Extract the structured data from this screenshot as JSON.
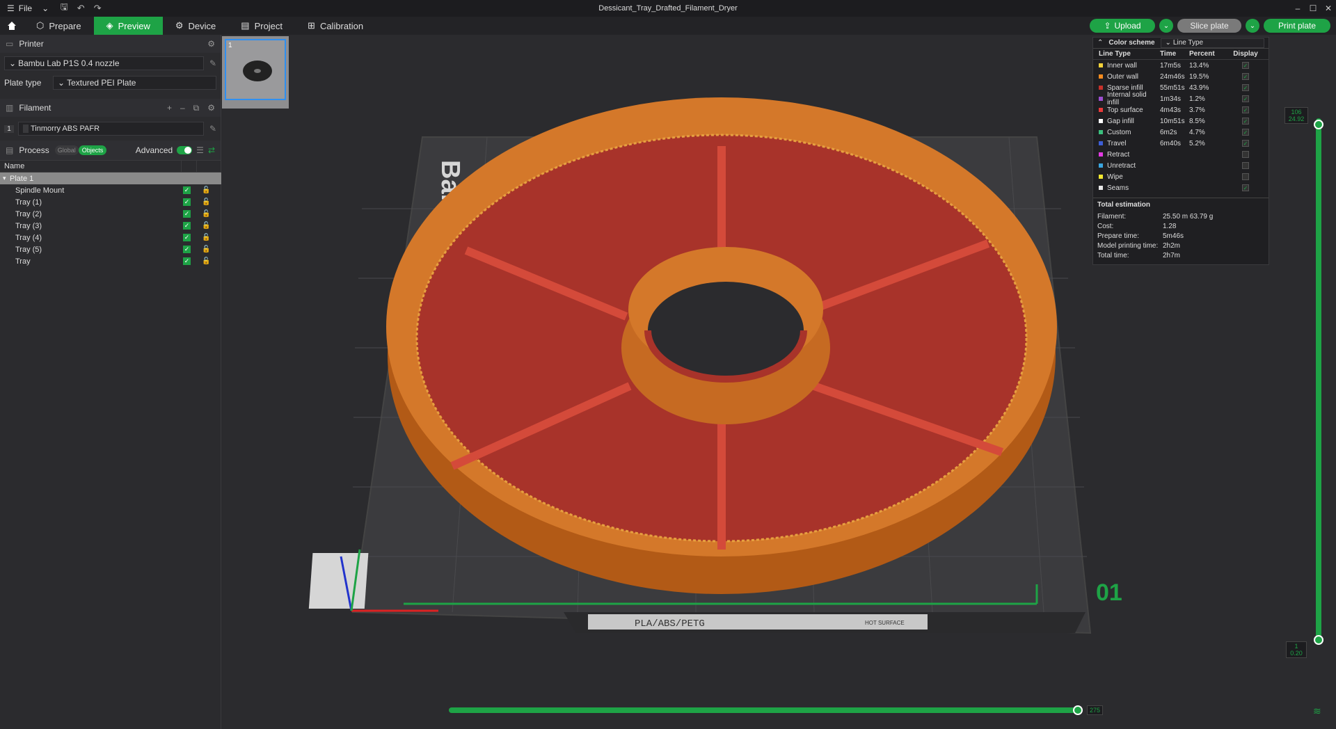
{
  "titlebar": {
    "file_label": "File",
    "title": "Dessicant_Tray_Drafted_Filament_Dryer"
  },
  "tabs": [
    {
      "label": "Prepare"
    },
    {
      "label": "Preview"
    },
    {
      "label": "Device"
    },
    {
      "label": "Project"
    },
    {
      "label": "Calibration"
    }
  ],
  "actions": {
    "upload": "Upload",
    "slice": "Slice plate",
    "print": "Print plate"
  },
  "printer": {
    "section_label": "Printer",
    "name": "Bambu Lab P1S 0.4 nozzle",
    "plate_type_label": "Plate type",
    "plate_type": "Textured PEI Plate"
  },
  "filament": {
    "section_label": "Filament",
    "index": "1",
    "name": "Tinmorry ABS PAFR"
  },
  "process": {
    "section_label": "Process",
    "global_label": "Global",
    "objects_label": "Objects",
    "advanced_label": "Advanced"
  },
  "objects": {
    "name_header": "Name",
    "plate_label": "Plate 1",
    "items": [
      "Spindle Mount",
      "Tray (1)",
      "Tray (2)",
      "Tray (3)",
      "Tray (4)",
      "Tray (5)",
      "Tray"
    ]
  },
  "thumbnail": {
    "index": "1"
  },
  "legend": {
    "scheme_label": "Color scheme",
    "scheme_value": "Line Type",
    "headers": [
      "Line Type",
      "Time",
      "Percent",
      "Display"
    ],
    "rows": [
      {
        "name": "Inner wall",
        "time": "17m5s",
        "percent": "13.4%",
        "color": "#f3d13a",
        "display": true
      },
      {
        "name": "Outer wall",
        "time": "24m46s",
        "percent": "19.5%",
        "color": "#f58b1f",
        "display": true
      },
      {
        "name": "Sparse infill",
        "time": "55m51s",
        "percent": "43.9%",
        "color": "#c6312b",
        "display": true
      },
      {
        "name": "Internal solid infill",
        "time": "1m34s",
        "percent": "1.2%",
        "color": "#9d4ed1",
        "display": true
      },
      {
        "name": "Top surface",
        "time": "4m43s",
        "percent": "3.7%",
        "color": "#e83a3a",
        "display": true
      },
      {
        "name": "Gap infill",
        "time": "10m51s",
        "percent": "8.5%",
        "color": "#ffffff",
        "display": true
      },
      {
        "name": "Custom",
        "time": "6m2s",
        "percent": "4.7%",
        "color": "#3bc07e",
        "display": true
      },
      {
        "name": "Travel",
        "time": "6m40s",
        "percent": "5.2%",
        "color": "#3d5ed6",
        "display": true
      },
      {
        "name": "Retract",
        "time": "",
        "percent": "",
        "color": "#e33be3",
        "display": false
      },
      {
        "name": "Unretract",
        "time": "",
        "percent": "",
        "color": "#3aa6e0",
        "display": false
      },
      {
        "name": "Wipe",
        "time": "",
        "percent": "",
        "color": "#f2e830",
        "display": false
      },
      {
        "name": "Seams",
        "time": "",
        "percent": "",
        "color": "#e8e8e8",
        "display": true
      }
    ],
    "total_label": "Total estimation",
    "totals": [
      {
        "k": "Filament:",
        "v": "25.50 m     63.79 g"
      },
      {
        "k": "Cost:",
        "v": "1.28"
      },
      {
        "k": "Prepare time:",
        "v": "5m46s"
      },
      {
        "k": "Model printing time:",
        "v": "2h2m"
      },
      {
        "k": "Total time:",
        "v": "2h7m"
      }
    ]
  },
  "bed": {
    "plate_number": "01",
    "label_materials": "PLA/ABS/PETG",
    "label_hot": "HOT SURFACE",
    "brand": "Bambu"
  },
  "sliders": {
    "top_layer": "106",
    "top_height": "24.92",
    "bottom_layer": "1",
    "bottom_height": "0.20",
    "horizontal_value": "275"
  },
  "colors": {
    "accent": "#1ea346",
    "tray_orange": "#c8641a",
    "tray_red": "#a8332a",
    "bed": "#3a3a3c"
  }
}
